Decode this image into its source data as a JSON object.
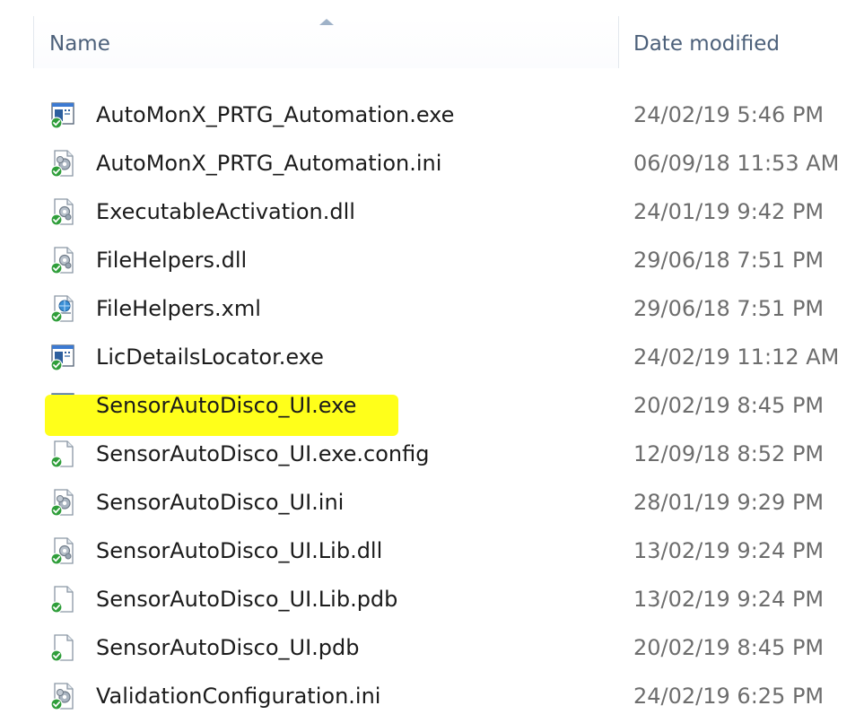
{
  "columns": {
    "name": "Name",
    "date_modified": "Date modified",
    "sort_column": "name",
    "sort_direction": "ascending"
  },
  "highlight_color": "#ffff1a",
  "files": [
    {
      "name": "AutoMonX_PRTG_Automation.exe",
      "date": "24/02/19 5:46 PM",
      "icon": "exe-file-icon",
      "highlighted": false
    },
    {
      "name": "AutoMonX_PRTG_Automation.ini",
      "date": "06/09/18 11:53 AM",
      "icon": "settings-file-icon",
      "highlighted": false
    },
    {
      "name": "ExecutableActivation.dll",
      "date": "24/01/19 9:42 PM",
      "icon": "dll-file-icon",
      "highlighted": false
    },
    {
      "name": "FileHelpers.dll",
      "date": "29/06/18 7:51 PM",
      "icon": "dll-file-icon",
      "highlighted": false
    },
    {
      "name": "FileHelpers.xml",
      "date": "29/06/18 7:51 PM",
      "icon": "xml-file-icon",
      "highlighted": false
    },
    {
      "name": "LicDetailsLocator.exe",
      "date": "24/02/19 11:12 AM",
      "icon": "exe-file-icon",
      "highlighted": false
    },
    {
      "name": "SensorAutoDisco_UI.exe",
      "date": "20/02/19 8:45 PM",
      "icon": "exe-file-icon",
      "highlighted": true
    },
    {
      "name": "SensorAutoDisco_UI.exe.config",
      "date": "12/09/18 8:52 PM",
      "icon": "blank-file-icon",
      "highlighted": false
    },
    {
      "name": "SensorAutoDisco_UI.ini",
      "date": "28/01/19 9:29 PM",
      "icon": "settings-file-icon",
      "highlighted": false
    },
    {
      "name": "SensorAutoDisco_UI.Lib.dll",
      "date": "13/02/19 9:24 PM",
      "icon": "dll-file-icon",
      "highlighted": false
    },
    {
      "name": "SensorAutoDisco_UI.Lib.pdb",
      "date": "13/02/19 9:24 PM",
      "icon": "blank-file-icon",
      "highlighted": false
    },
    {
      "name": "SensorAutoDisco_UI.pdb",
      "date": "20/02/19 8:45 PM",
      "icon": "blank-file-icon",
      "highlighted": false
    },
    {
      "name": "ValidationConfiguration.ini",
      "date": "24/02/19 6:25 PM",
      "icon": "settings-file-icon",
      "highlighted": false
    }
  ]
}
